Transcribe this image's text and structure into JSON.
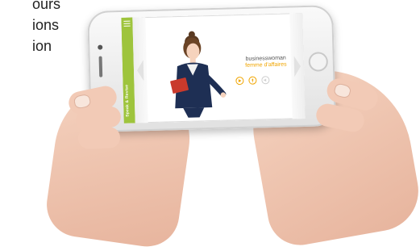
{
  "background_text": [
    "ours",
    "ions",
    "ion"
  ],
  "app": {
    "sidebar_label": "Speak & Revise",
    "word_en": "businesswoman",
    "word_fr": "femme d'affaires",
    "accent_color": "#9ec43c",
    "highlight_color": "#f0a500",
    "controls": [
      {
        "icon": "play-icon",
        "enabled": true
      },
      {
        "icon": "microphone-icon",
        "enabled": true
      },
      {
        "icon": "speaker-icon",
        "enabled": false
      }
    ]
  }
}
